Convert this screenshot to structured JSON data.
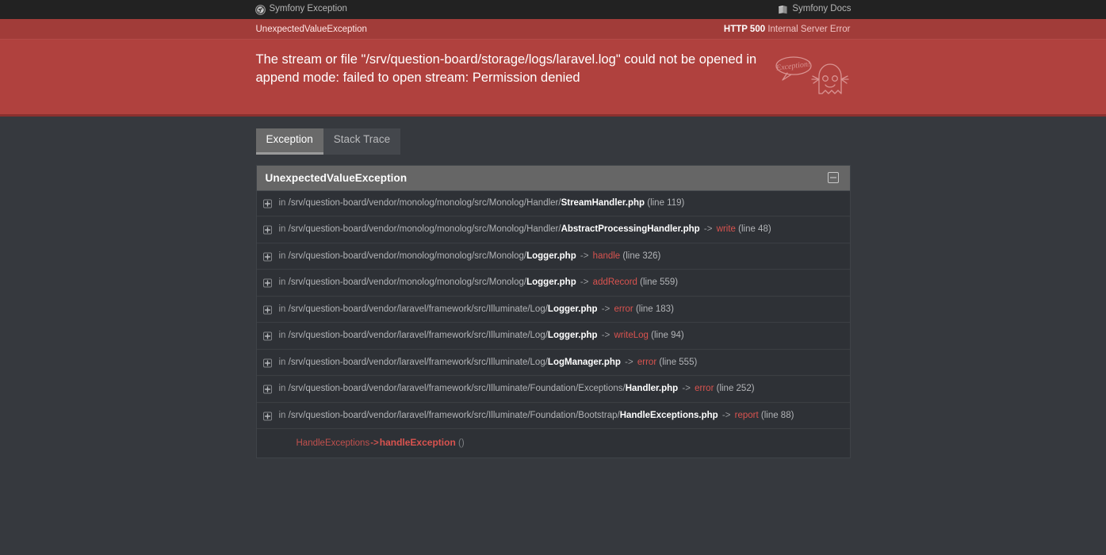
{
  "topnav": {
    "left_label": "Symfony Exception",
    "left_icon": "symfony-logo-icon",
    "right_label": "Symfony Docs",
    "right_icon": "book-icon"
  },
  "strip": {
    "exception_class": "UnexpectedValueException",
    "status_code": "HTTP 500",
    "status_text": "Internal Server Error"
  },
  "banner": {
    "message": "The stream or file \"/srv/question-board/storage/logs/laravel.log\" could not be opened in append mode: failed to open stream: Permission denied",
    "mascot_speech": "Exception!",
    "mascot_icon": "ghost-mascot-icon",
    "background_color": "#b0413e"
  },
  "tabs": [
    {
      "label": "Exception",
      "active": true
    },
    {
      "label": "Stack Trace",
      "active": false
    }
  ],
  "exception_panel": {
    "title": "UnexpectedValueException",
    "toggle_icon": "collapse-minus-icon",
    "expand_icon": "expand-plus-icon",
    "prefix": "in",
    "arrow": "->",
    "rows": [
      {
        "path": "/srv/question-board/vendor/monolog/monolog/src/Monolog/Handler/",
        "file": "StreamHandler.php",
        "function": "",
        "line": "(line 119)"
      },
      {
        "path": "/srv/question-board/vendor/monolog/monolog/src/Monolog/Handler/",
        "file": "AbstractProcessingHandler.php",
        "function": "write",
        "line": "(line 48)"
      },
      {
        "path": "/srv/question-board/vendor/monolog/monolog/src/Monolog/",
        "file": "Logger.php",
        "function": "handle",
        "line": "(line 326)"
      },
      {
        "path": "/srv/question-board/vendor/monolog/monolog/src/Monolog/",
        "file": "Logger.php",
        "function": "addRecord",
        "line": "(line 559)"
      },
      {
        "path": "/srv/question-board/vendor/laravel/framework/src/Illuminate/Log/",
        "file": "Logger.php",
        "function": "error",
        "line": "(line 183)"
      },
      {
        "path": "/srv/question-board/vendor/laravel/framework/src/Illuminate/Log/",
        "file": "Logger.php",
        "function": "writeLog",
        "line": "(line 94)"
      },
      {
        "path": "/srv/question-board/vendor/laravel/framework/src/Illuminate/Log/",
        "file": "LogManager.php",
        "function": "error",
        "line": "(line 555)"
      },
      {
        "path": "/srv/question-board/vendor/laravel/framework/src/Illuminate/Foundation/Exceptions/",
        "file": "Handler.php",
        "function": "error",
        "line": "(line 252)"
      },
      {
        "path": "/srv/question-board/vendor/laravel/framework/src/Illuminate/Foundation/Bootstrap/",
        "file": "HandleExceptions.php",
        "function": "report",
        "line": "(line 88)"
      }
    ],
    "final_call": {
      "class": "HandleExceptions",
      "arrow": "->",
      "method": "handleException",
      "parens": "()"
    }
  },
  "colors": {
    "page_background": "#36393e",
    "nav_background": "#222222",
    "strip_background": "#a13c39",
    "panel_header": "#666666",
    "row_background": "#2e3136",
    "accent_red": "#d9534f"
  }
}
